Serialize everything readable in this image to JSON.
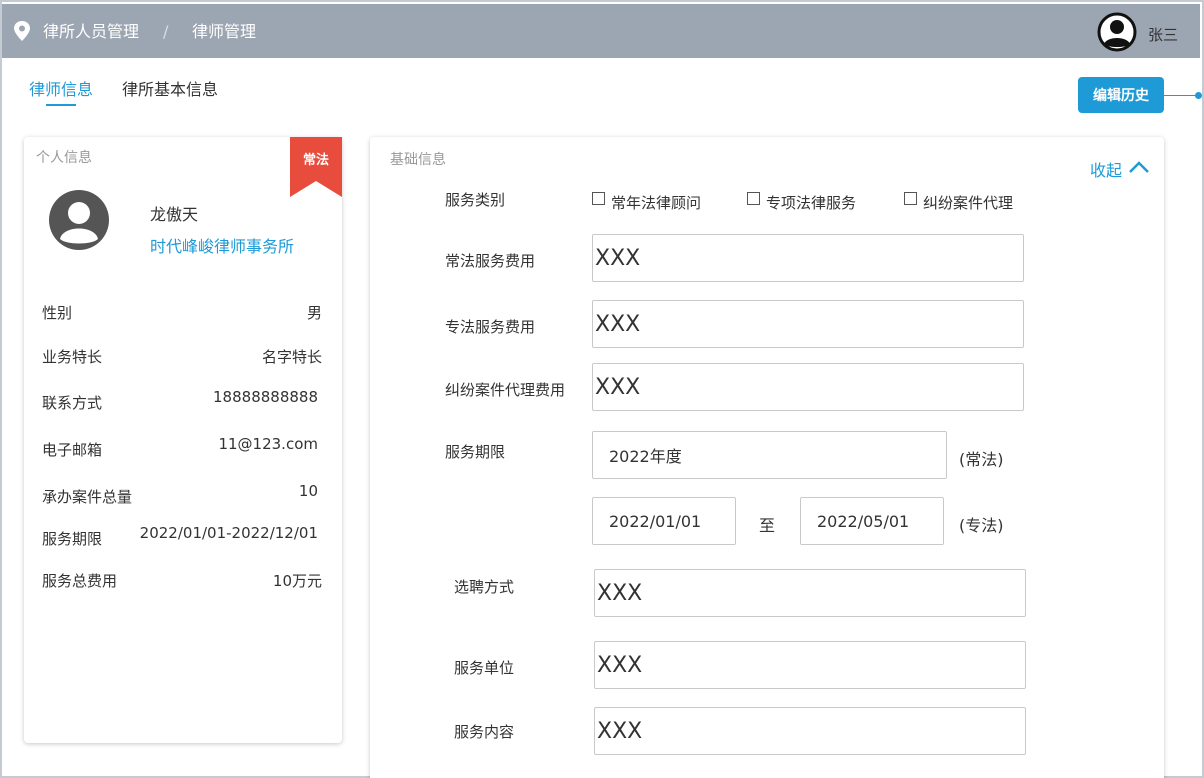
{
  "header": {
    "breadcrumb": [
      "律所人员管理",
      "律师管理"
    ],
    "separator": "/",
    "username": "张三"
  },
  "tabs": [
    "律师信息",
    "律所基本信息"
  ],
  "history_button": "编辑历史",
  "personal": {
    "title": "个人信息",
    "badge": "常法",
    "name": "龙傲天",
    "firm": "时代峰峻律师事务所",
    "rows": [
      {
        "label": "性别",
        "value": "男"
      },
      {
        "label": "业务特长",
        "value": "名字特长"
      },
      {
        "label": "联系方式",
        "value": "18888888888"
      },
      {
        "label": "电子邮箱",
        "value": "11@123.com"
      },
      {
        "label": "承办案件总量",
        "value": "10"
      },
      {
        "label": "服务期限",
        "value": "2022/01/01-2022/12/01"
      },
      {
        "label": "服务总费用",
        "value": "10万元"
      }
    ]
  },
  "basic": {
    "title": "基础信息",
    "collapse": "收起",
    "service_type_label": "服务类别",
    "service_types": [
      "常年法律顾问",
      "专项法律服务",
      "纠纷案件代理"
    ],
    "fields": {
      "regular_fee": {
        "label": "常法服务费用",
        "value": "XXX"
      },
      "special_fee": {
        "label": "专法服务费用",
        "value": "XXX"
      },
      "dispute_fee": {
        "label": "纠纷案件代理费用",
        "value": "XXX"
      },
      "term_label": "服务期限",
      "term_regular": "2022年度",
      "term_regular_tag": "(常法)",
      "term_start": "2022/01/01",
      "term_to": "至",
      "term_end": "2022/05/01",
      "term_special_tag": "(专法)",
      "hire_method": {
        "label": "选聘方式",
        "value": "XXX"
      },
      "service_unit": {
        "label": "服务单位",
        "value": "XXX"
      },
      "service_content": {
        "label": "服务内容",
        "value": "XXX"
      }
    }
  },
  "colors": {
    "accent": "#1e9bd7",
    "topbar": "#9ca6b2",
    "badge": "#e74c3c"
  }
}
